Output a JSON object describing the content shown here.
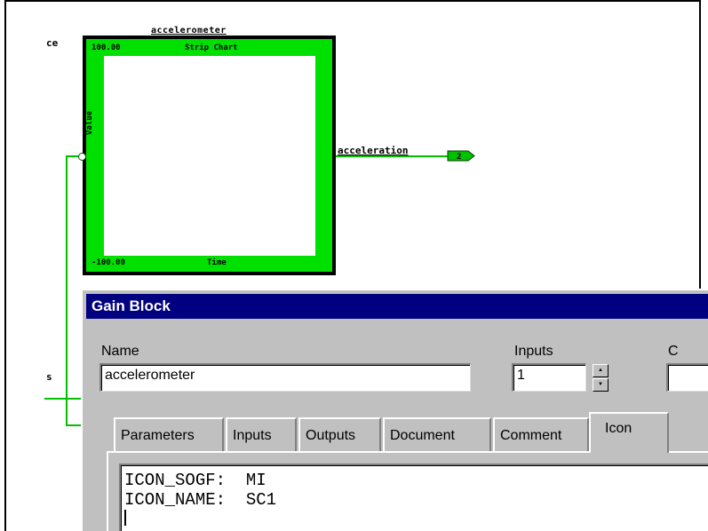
{
  "diagram": {
    "left_cut_top": "ce",
    "left_cut_bottom": "s",
    "block_title": "accelerometer",
    "chart_title": "Strip Chart",
    "y_max": "100.00",
    "y_min": "-100.00",
    "x_label": "Time",
    "y_label": "Value",
    "output_label": "acceleration",
    "output_tag": "2",
    "colors": {
      "block_green": "#00e000",
      "wire": "#00c000",
      "title_bar": "#000080"
    }
  },
  "dialog": {
    "title": "Gain Block",
    "name_label": "Name",
    "name_value": "accelerometer",
    "inputs_label": "Inputs",
    "inputs_value": "1",
    "outputs_label_cut": "C",
    "tabs": [
      {
        "label": "Parameters"
      },
      {
        "label": "Inputs"
      },
      {
        "label": "Outputs"
      },
      {
        "label": "Document"
      },
      {
        "label": "Comment"
      },
      {
        "label": "Icon"
      }
    ],
    "icon_text_line1": "ICON_SOGF:  MI",
    "icon_text_line2": "ICON_NAME:  SC1"
  }
}
